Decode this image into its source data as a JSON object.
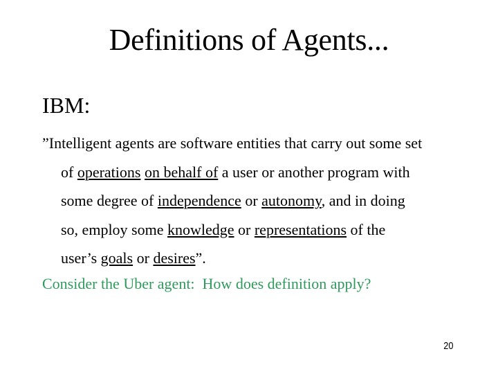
{
  "slide": {
    "title": "Definitions of Agents...",
    "heading": "IBM:",
    "definition_lines": [
      [
        {
          "text": "”Intelligent agents are software entities that carry out some set",
          "underline": false
        }
      ],
      [
        {
          "text": "of ",
          "underline": false
        },
        {
          "text": "operations",
          "underline": true
        },
        {
          "text": " ",
          "underline": false
        },
        {
          "text": "on behalf of",
          "underline": true
        },
        {
          "text": " a user or another program with",
          "underline": false
        }
      ],
      [
        {
          "text": "some degree of ",
          "underline": false
        },
        {
          "text": "independence",
          "underline": true
        },
        {
          "text": " or ",
          "underline": false
        },
        {
          "text": "autonomy",
          "underline": true
        },
        {
          "text": ", and in doing",
          "underline": false
        }
      ],
      [
        {
          "text": "so, employ some ",
          "underline": false
        },
        {
          "text": "knowledge",
          "underline": true
        },
        {
          "text": " or ",
          "underline": false
        },
        {
          "text": "representations",
          "underline": true
        },
        {
          "text": " of the",
          "underline": false
        }
      ],
      [
        {
          "text": "user’s ",
          "underline": false
        },
        {
          "text": "goals",
          "underline": true
        },
        {
          "text": " or ",
          "underline": false
        },
        {
          "text": "desires",
          "underline": true
        },
        {
          "text": "”.",
          "underline": false
        }
      ]
    ],
    "question": "Consider the Uber agent:  How does definition apply?",
    "question_color": "#2e9a5c",
    "page_number": "20"
  }
}
